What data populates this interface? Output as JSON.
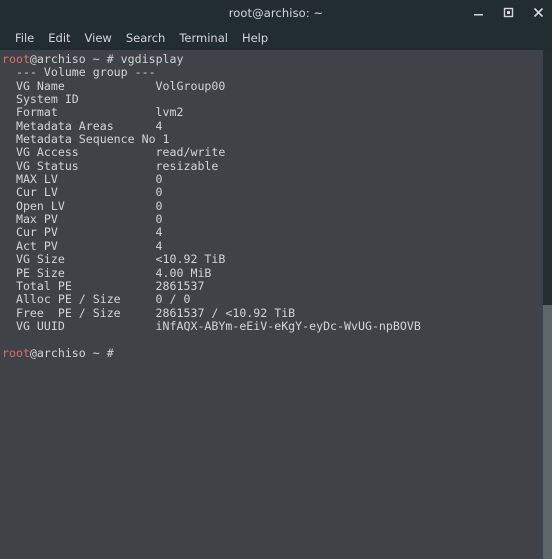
{
  "window": {
    "title": "root@archiso: ~",
    "controls": [
      {
        "name": "minimize",
        "label": "—"
      },
      {
        "name": "maximize",
        "label": "□"
      },
      {
        "name": "close",
        "label": "✕"
      }
    ]
  },
  "menubar": {
    "items": [
      {
        "label": "File"
      },
      {
        "label": "Edit"
      },
      {
        "label": "View"
      },
      {
        "label": "Search"
      },
      {
        "label": "Terminal"
      },
      {
        "label": "Help"
      }
    ]
  },
  "terminal": {
    "prompt": {
      "user": "root",
      "rest": "@archiso ~ # "
    },
    "command": "vgdisplay",
    "header": "  --- Volume group ---",
    "rows": [
      {
        "key": "  VG Name",
        "value": "VolGroup00"
      },
      {
        "key": "  System ID",
        "value": ""
      },
      {
        "key": "  Format",
        "value": "lvm2"
      },
      {
        "key": "  Metadata Areas",
        "value": "4"
      },
      {
        "key": "  Metadata Sequence No",
        "value": "1"
      },
      {
        "key": "  VG Access",
        "value": "read/write"
      },
      {
        "key": "  VG Status",
        "value": "resizable"
      },
      {
        "key": "  MAX LV",
        "value": "0"
      },
      {
        "key": "  Cur LV",
        "value": "0"
      },
      {
        "key": "  Open LV",
        "value": "0"
      },
      {
        "key": "  Max PV",
        "value": "0"
      },
      {
        "key": "  Cur PV",
        "value": "4"
      },
      {
        "key": "  Act PV",
        "value": "4"
      },
      {
        "key": "  VG Size",
        "value": "<10.92 TiB"
      },
      {
        "key": "  PE Size",
        "value": "4.00 MiB"
      },
      {
        "key": "  Total PE",
        "value": "2861537"
      },
      {
        "key": "  Alloc PE / Size",
        "value": "0 / 0"
      },
      {
        "key": "  Free  PE / Size",
        "value": "2861537 / <10.92 TiB"
      },
      {
        "key": "  VG UUID",
        "value": "iNfAQX-ABYm-eEiV-eKgY-eyDc-WvUG-npBOVB"
      }
    ]
  },
  "scrollbar": {
    "thumb_top_percent": 50,
    "thumb_height_percent": 50
  },
  "colors": {
    "titlebar_bg": "#222d32",
    "terminal_bg": "#3f4347",
    "terminal_fg": "#d3d4d5",
    "prompt_user": "#e06c6c",
    "scrollbar_trough": "#242e33",
    "scrollbar_thumb": "#5d666b"
  }
}
